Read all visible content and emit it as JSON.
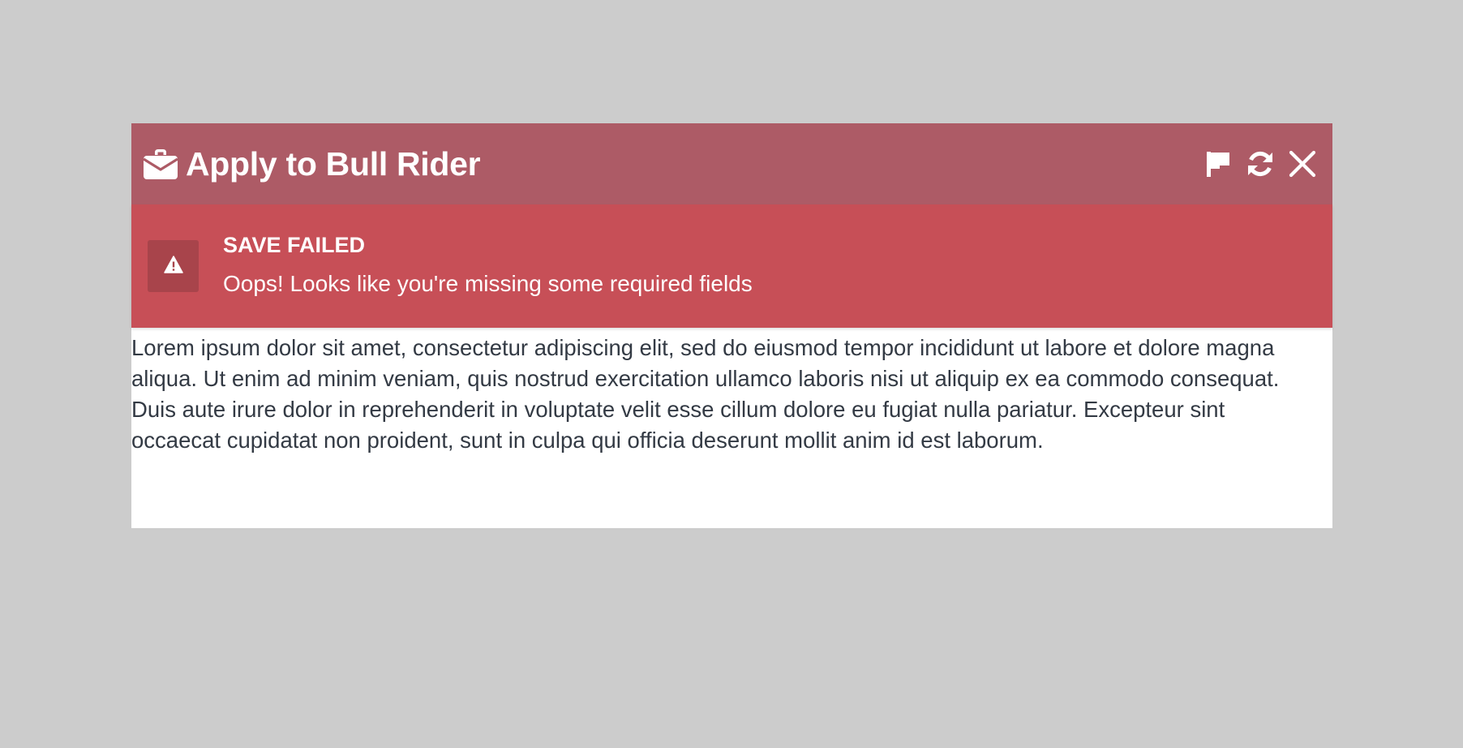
{
  "modal": {
    "title": "Apply to Bull Rider",
    "title_icon": "briefcase-envelope-icon",
    "actions": [
      {
        "name": "flag-icon"
      },
      {
        "name": "refresh-icon"
      },
      {
        "name": "close-icon"
      }
    ]
  },
  "alert": {
    "icon": "warning-icon",
    "title": "SAVE FAILED",
    "message": "Oops! Looks like you're missing some required fields"
  },
  "content": {
    "paragraph": "Lorem ipsum dolor sit amet, consectetur adipiscing elit, sed do eiusmod tempor incididunt ut labore et dolore magna aliqua. Ut enim ad minim veniam, quis nostrud exercitation ullamco laboris nisi ut aliquip ex ea commodo consequat. Duis aute irure dolor in reprehenderit in voluptate velit esse cillum dolore eu fugiat nulla pariatur. Excepteur sint occaecat cupidatat non proident, sunt in culpa qui officia deserunt mollit anim id est laborum."
  },
  "colors": {
    "page_background": "#cccccc",
    "header_background": "#ad5b66",
    "alert_background": "#c74f57",
    "alert_icon_box": "#a8444b",
    "body_text": "#333a44"
  }
}
